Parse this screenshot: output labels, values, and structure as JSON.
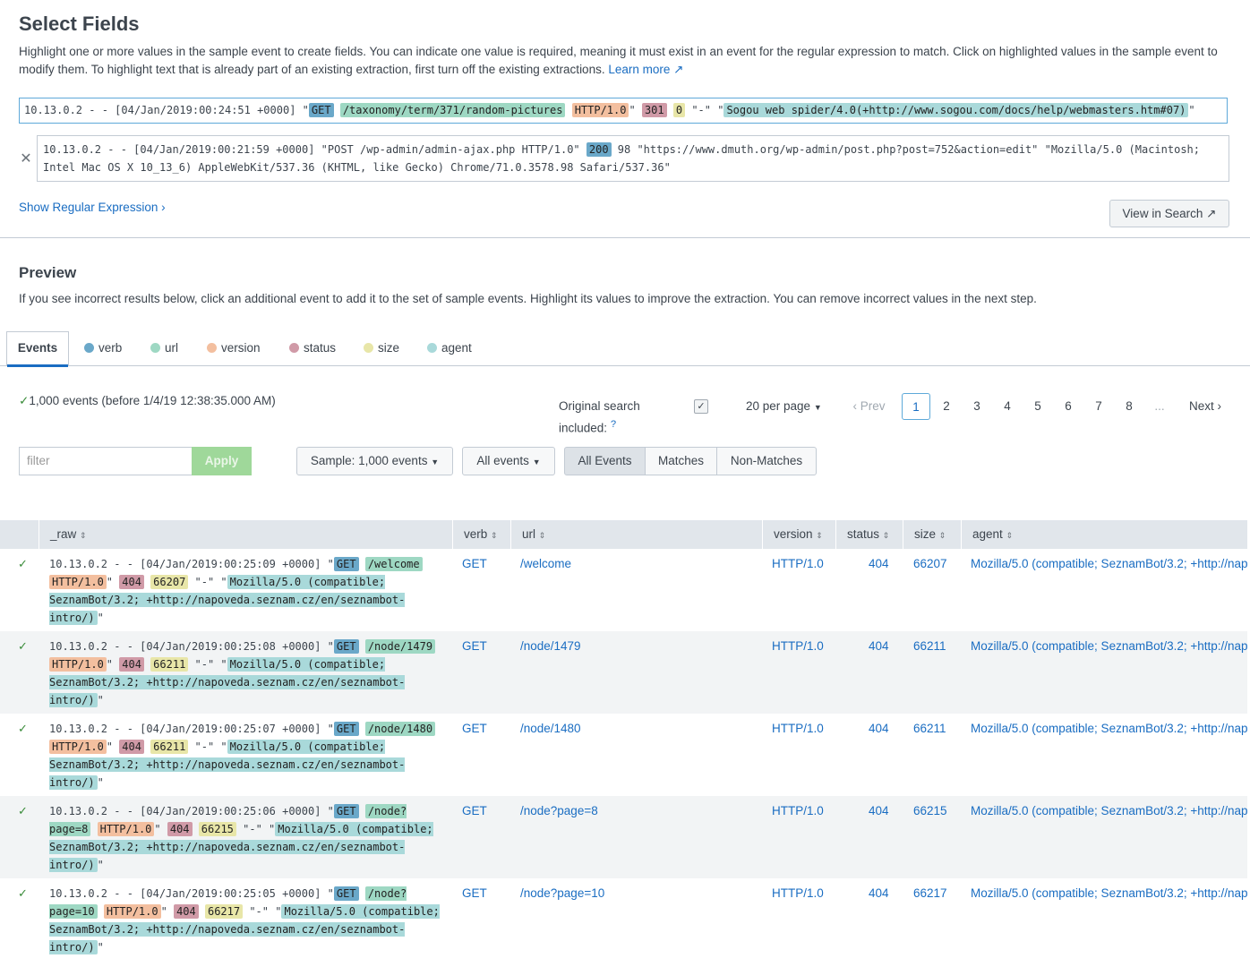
{
  "header": {
    "title": "Select Fields",
    "description": "Highlight one or more values in the sample event to create fields. You can indicate one value is required, meaning it must exist in an event for the regular expression to match. Click on highlighted values in the sample event to modify them. To highlight text that is already part of an existing extraction, first turn off the existing extractions.",
    "learn_more": "Learn more"
  },
  "sample_event": {
    "prefix": "10.13.0.2 - - [04/Jan/2019:00:24:51 +0000] \"",
    "verb": "GET",
    "url": "/taxonomy/term/371/random-pictures",
    "version": "HTTP/1.0",
    "status": "301",
    "size": "0",
    "dash": "\"-\" \"",
    "agent": "Sogou web spider/4.0(+http://www.sogou.com/docs/help/webmasters.htm#07)",
    "suffix": "\""
  },
  "extra_event": {
    "text_before": "10.13.0.2 - - [04/Jan/2019:00:21:59 +0000] \"POST /wp-admin/admin-ajax.php HTTP/1.0\" ",
    "status": "200",
    "text_after": " 98 \"https://www.dmuth.org/wp-admin/post.php?post=752&action=edit\" \"Mozilla/5.0 (Macintosh; Intel Mac OS X 10_13_6) AppleWebKit/537.36 (KHTML, like Gecko) Chrome/71.0.3578.98 Safari/537.36\""
  },
  "show_regex": "Show Regular Expression",
  "view_in_search": "View in Search",
  "preview": {
    "title": "Preview",
    "description": "If you see incorrect results below, click an additional event to add it to the set of sample events. Highlight its values to improve the extraction. You can remove incorrect values in the next step."
  },
  "tabs": {
    "events": "Events",
    "fields": [
      {
        "label": "verb",
        "color": "#6aa8c9"
      },
      {
        "label": "url",
        "color": "#9ed8c3"
      },
      {
        "label": "version",
        "color": "#f3bf9f"
      },
      {
        "label": "status",
        "color": "#d09aa7"
      },
      {
        "label": "size",
        "color": "#e8e6a8"
      },
      {
        "label": "agent",
        "color": "#a9d9da"
      }
    ]
  },
  "toolbar": {
    "events_count": "1,000 events (before 1/4/19 12:38:35.000 AM)",
    "original_search_line1": "Original search",
    "original_search_line2": "included:",
    "per_page": "20 per page",
    "prev": "Prev",
    "pages": [
      "1",
      "2",
      "3",
      "4",
      "5",
      "6",
      "7",
      "8",
      "..."
    ],
    "next": "Next",
    "filter_placeholder": "filter",
    "apply": "Apply",
    "sample": "Sample: 1,000 events",
    "all_events_dd": "All events",
    "seg_all": "All Events",
    "seg_matches": "Matches",
    "seg_nonmatches": "Non-Matches"
  },
  "table": {
    "columns": [
      "_raw",
      "verb",
      "url",
      "version",
      "status",
      "size",
      "agent"
    ],
    "rows": [
      {
        "ts": "25:09",
        "verb": "GET",
        "url": "/welcome",
        "version": "HTTP/1.0",
        "status": "404",
        "size": "66207",
        "agent": "Mozilla/5.0 (compatible; SeznamBot/3.2; +http://napoveda.seznam.cz/en/seznambot-intro/)"
      },
      {
        "ts": "25:08",
        "verb": "GET",
        "url": "/node/1479",
        "version": "HTTP/1.0",
        "status": "404",
        "size": "66211",
        "agent": "Mozilla/5.0 (compatible; SeznamBot/3.2; +http://napoveda.seznam.cz/en/seznambot-intro/)"
      },
      {
        "ts": "25:07",
        "verb": "GET",
        "url": "/node/1480",
        "version": "HTTP/1.0",
        "status": "404",
        "size": "66211",
        "agent": "Mozilla/5.0 (compatible; SeznamBot/3.2; +http://napoveda.seznam.cz/en/seznambot-intro/)"
      },
      {
        "ts": "25:06",
        "verb": "GET",
        "url": "/node?page=8",
        "version": "HTTP/1.0",
        "status": "404",
        "size": "66215",
        "agent": "Mozilla/5.0 (compatible; SeznamBot/3.2; +http://napoveda.seznam.cz/en/seznambot-intro/)"
      },
      {
        "ts": "25:05",
        "verb": "GET",
        "url": "/node?page=10",
        "version": "HTTP/1.0",
        "status": "404",
        "size": "66217",
        "agent": "Mozilla/5.0 (compatible; SeznamBot/3.2; +http://napoveda.seznam.cz/en/seznambot-intro/)"
      }
    ]
  }
}
